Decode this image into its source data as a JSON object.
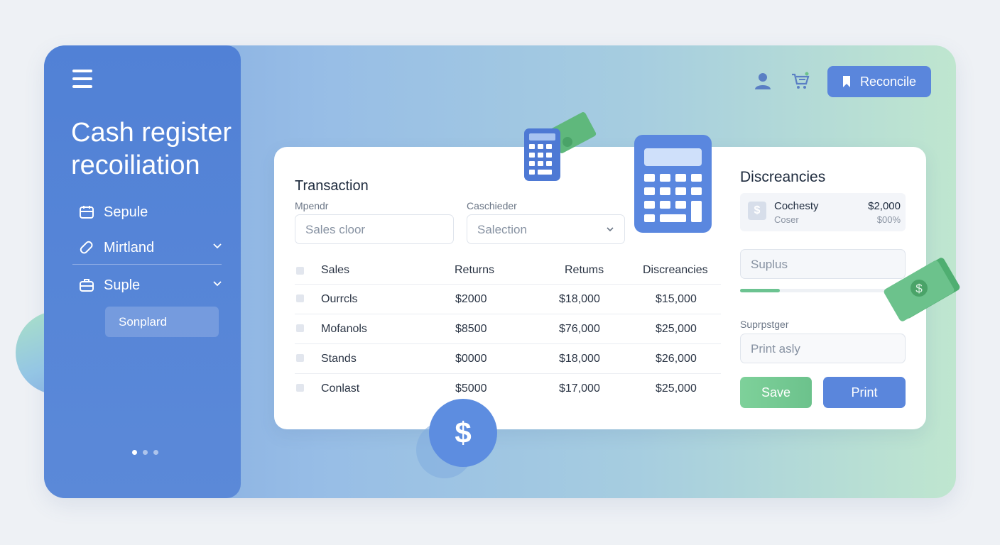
{
  "sidebar": {
    "title_line1": "Cash register",
    "title_line2": "recoiliation",
    "items": [
      {
        "label": "Sepule",
        "icon": "calendar-icon"
      },
      {
        "label": "Mirtland",
        "icon": "tag-icon"
      },
      {
        "label": "Suple",
        "icon": "briefcase-icon"
      }
    ],
    "sub_item": "Sonplard"
  },
  "header": {
    "reconcile_label": "Reconcile"
  },
  "transaction": {
    "title": "Transaction",
    "field1_label": "Mpendr",
    "field1_placeholder": "Sales cloor",
    "field2_label": "Caschieder",
    "field2_value": "Salection",
    "columns": [
      "Sales",
      "Returns",
      "Retums",
      "Discreancies"
    ],
    "rows": [
      [
        "Ourrcls",
        "$2000",
        "$18,000",
        "$15,000"
      ],
      [
        "Mofanols",
        "$8500",
        "$76,000",
        "$25,000"
      ],
      [
        "Stands",
        "$0000",
        "$18,000",
        "$26,000"
      ],
      [
        "Conlast",
        "$5000",
        "$17,000",
        "$25,000"
      ]
    ]
  },
  "discrepancies": {
    "title": "Discreancies",
    "item_name": "Cochesty",
    "item_sub": "Coser",
    "item_amount": "$2,000",
    "item_percent": "$00%",
    "surplus_placeholder": "Suplus",
    "progress": 0.24,
    "supervisor_label": "Suprpstger",
    "print_placeholder": "Print asly",
    "save_label": "Save",
    "print_label": "Print"
  },
  "colors": {
    "sidebar": "#5181d6",
    "primary": "#5a86dc",
    "success": "#6cc28c"
  }
}
